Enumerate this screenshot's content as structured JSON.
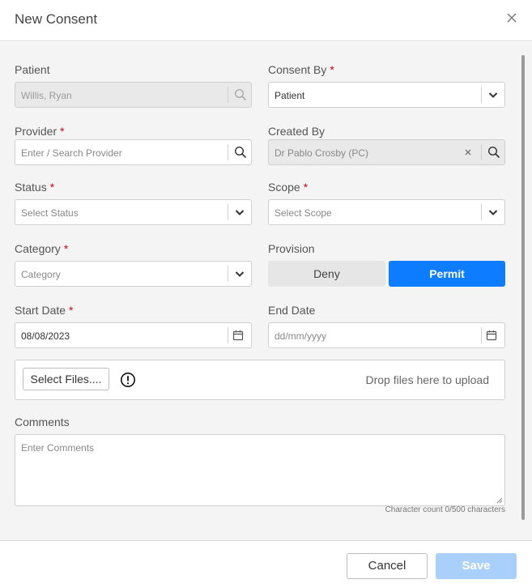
{
  "dialog": {
    "title": "New Consent"
  },
  "fields": {
    "patient": {
      "label": "Patient",
      "value": "Willis, Ryan"
    },
    "consent_by": {
      "label": "Consent By",
      "required": "*",
      "value": "Patient"
    },
    "provider": {
      "label": "Provider",
      "required": "*",
      "placeholder": "Enter / Search Provider"
    },
    "created_by": {
      "label": "Created By",
      "value": "Dr Pablo Crosby (PC)"
    },
    "status": {
      "label": "Status",
      "required": "*",
      "placeholder": "Select Status"
    },
    "scope": {
      "label": "Scope",
      "required": "*",
      "placeholder": "Select Scope"
    },
    "category": {
      "label": "Category",
      "required": "*",
      "placeholder": "Category"
    },
    "provision": {
      "label": "Provision",
      "options": [
        "Deny",
        "Permit"
      ],
      "selected": "Permit"
    },
    "start_date": {
      "label": "Start Date",
      "required": "*",
      "value": "08/08/2023"
    },
    "end_date": {
      "label": "End Date",
      "placeholder": "dd/mm/yyyy"
    }
  },
  "upload": {
    "button_label": "Select Files....",
    "drop_text": "Drop files here to upload"
  },
  "comments": {
    "label": "Comments",
    "placeholder": "Enter Comments",
    "char_count": "Character count 0/500 characters"
  },
  "footer": {
    "cancel_label": "Cancel",
    "save_label": "Save"
  },
  "colors": {
    "primary": "#0d7cff",
    "required": "#d0021b",
    "save_disabled": "#a9d0fb"
  }
}
